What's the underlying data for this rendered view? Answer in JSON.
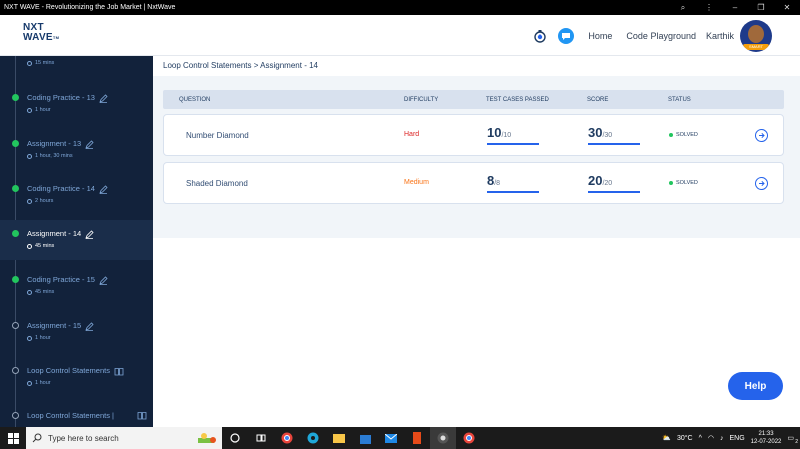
{
  "window": {
    "title": "NXT WAVE - Revolutionizing the Job Market | NxtWave"
  },
  "header": {
    "logo_line1": "NXT",
    "logo_line2": "WAVE",
    "logo_tm": "TM",
    "nav": [
      "Home",
      "Code Playground"
    ],
    "user_name": "Karthik",
    "avatar_badge": "SMART"
  },
  "sidebar": {
    "items": [
      {
        "title": "",
        "meta": "15 mins",
        "state": "done",
        "edit": false,
        "active": false
      },
      {
        "title": "Coding Practice - 13",
        "meta": "1 hour",
        "state": "done",
        "edit": true,
        "active": false
      },
      {
        "title": "Assignment - 13",
        "meta": "1 hour, 30 mins",
        "state": "done",
        "edit": true,
        "active": false
      },
      {
        "title": "Coding Practice - 14",
        "meta": "2 hours",
        "state": "done",
        "edit": true,
        "active": false
      },
      {
        "title": "Assignment - 14",
        "meta": "45 mins",
        "state": "done",
        "edit": true,
        "active": true
      },
      {
        "title": "Coding Practice - 15",
        "meta": "45 mins",
        "state": "done",
        "edit": true,
        "active": false
      },
      {
        "title": "Assignment - 15",
        "meta": "1 hour",
        "state": "todo",
        "edit": true,
        "active": false
      },
      {
        "title": "Loop Control Statements",
        "meta": "1 hour",
        "state": "todo",
        "edit": false,
        "active": false
      },
      {
        "title": "Loop Control Statements |",
        "meta": "",
        "state": "todo",
        "edit": false,
        "active": false
      }
    ]
  },
  "main": {
    "breadcrumb": "Loop Control Statements > Assignment - 14",
    "columns": {
      "question": "QUESTION",
      "difficulty": "DIFFICULTY",
      "test_cases": "TEST CASES PASSED",
      "score": "SCORE",
      "status": "STATUS"
    },
    "rows": [
      {
        "question": "Number Diamond",
        "difficulty": "Hard",
        "difficulty_color": "#dc2626",
        "tc_passed": "10",
        "tc_total": "/10",
        "score": "30",
        "score_total": "/30",
        "status": "SOLVED",
        "status_color": "#22c55e"
      },
      {
        "question": "Shaded Diamond",
        "difficulty": "Medium",
        "difficulty_color": "#f97316",
        "tc_passed": "8",
        "tc_total": "/8",
        "score": "20",
        "score_total": "/20",
        "status": "SOLVED",
        "status_color": "#22c55e"
      }
    ],
    "help_label": "Help"
  },
  "taskbar": {
    "search_placeholder": "Type here to search",
    "temperature": "30°C",
    "language": "ENG",
    "time": "21:33",
    "date": "12-07-2022",
    "notification_count": "2"
  }
}
